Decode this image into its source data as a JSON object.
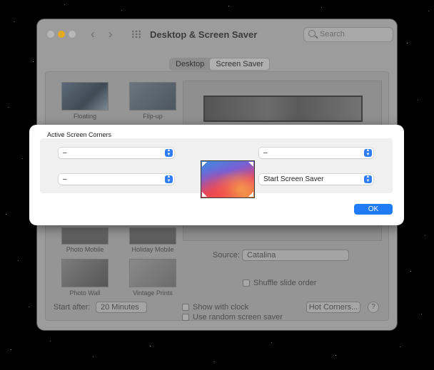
{
  "window": {
    "title": "Desktop & Screen Saver",
    "search_placeholder": "Search",
    "tabs": [
      {
        "label": "Desktop",
        "active": false
      },
      {
        "label": "Screen Saver",
        "active": true
      }
    ],
    "screensavers": [
      {
        "label": "Floating"
      },
      {
        "label": "Flip-up"
      },
      {
        "label": "Photo Mobile"
      },
      {
        "label": "Holiday Mobile"
      },
      {
        "label": "Photo Wall"
      },
      {
        "label": "Vintage Prints"
      }
    ],
    "source_label": "Source:",
    "source_value": "Catalina",
    "shuffle_label": "Shuffle slide order",
    "start_after_label": "Start after:",
    "start_after_value": "20 Minutes",
    "show_clock_label": "Show with clock",
    "random_saver_label": "Use random screen saver",
    "hot_corners_label": "Hot Corners...",
    "help_label": "?"
  },
  "sheet": {
    "title": "Active Screen Corners",
    "top_left": "–",
    "top_right": "–",
    "bottom_left": "–",
    "bottom_right": "Start Screen Saver",
    "ok_label": "OK"
  },
  "colors": {
    "accent": "#1f7cf5",
    "minimize": "#e6aa1f"
  }
}
